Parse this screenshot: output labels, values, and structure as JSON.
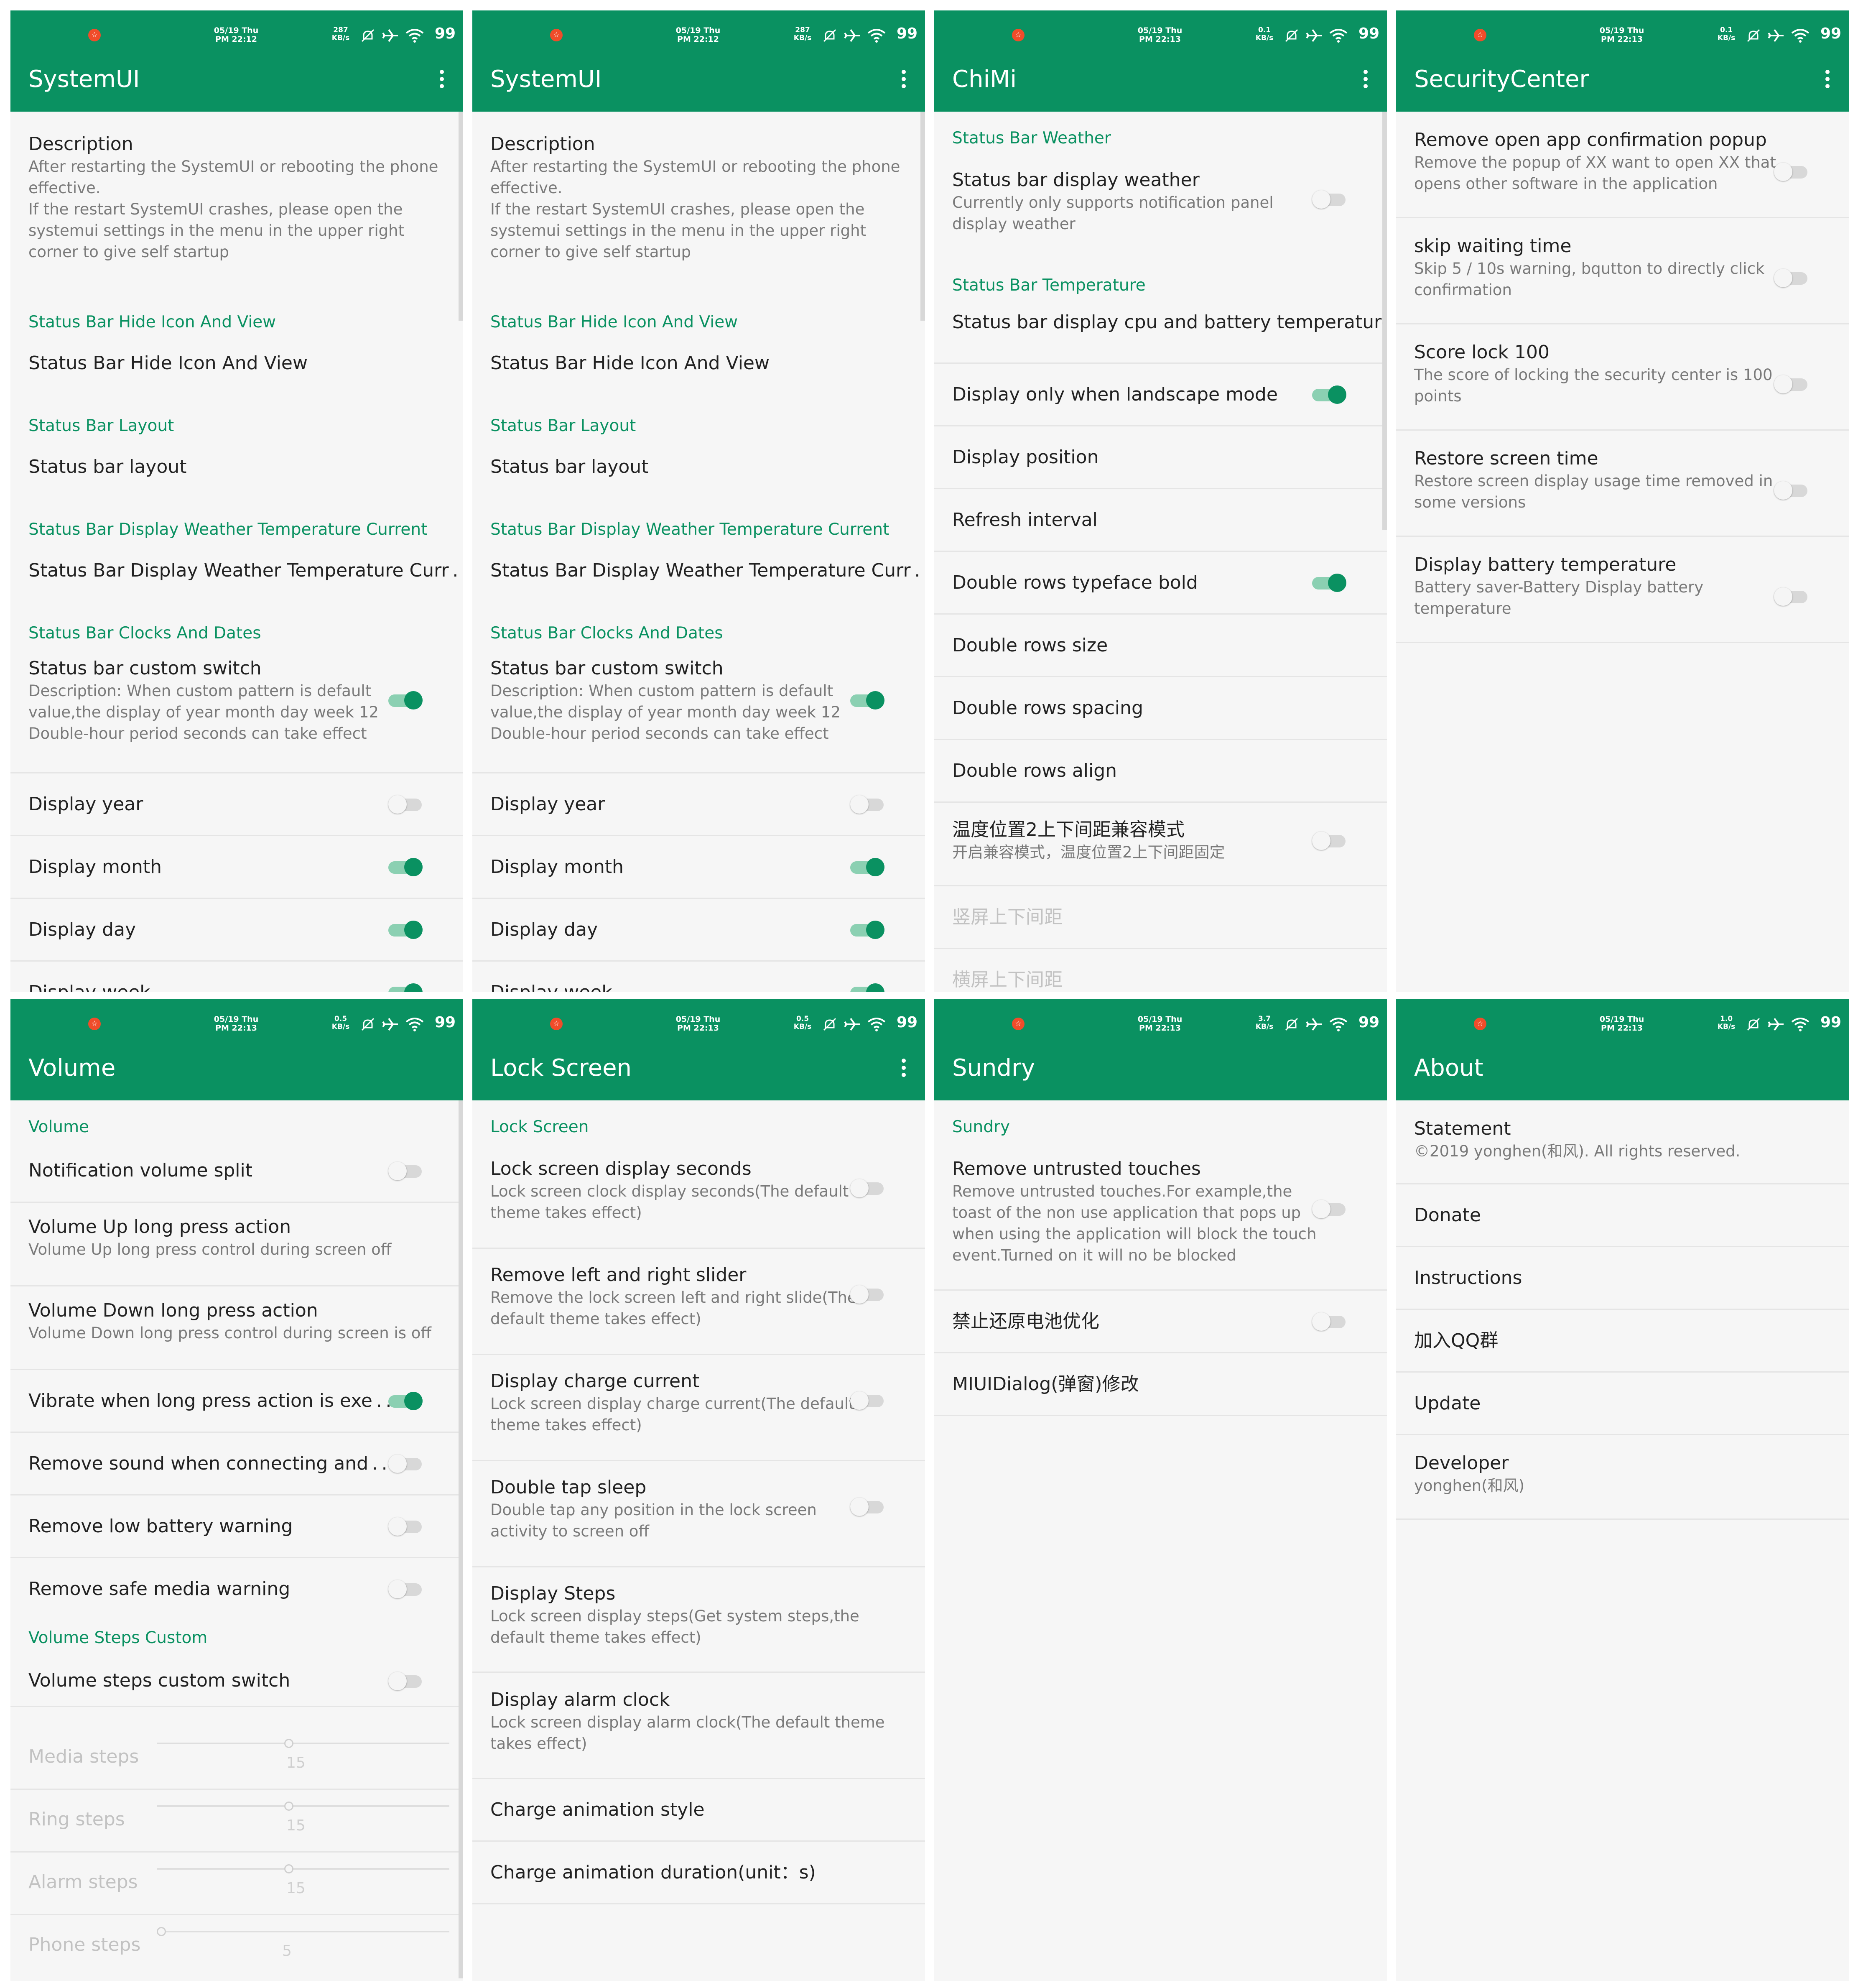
{
  "statusbar": {
    "panels": [
      {
        "date": "05/19 Thu",
        "time": "PM 22:12",
        "speed": "287",
        "speed_unit": "KB/s",
        "battery": "99"
      },
      {
        "date": "05/19 Thu",
        "time": "PM 22:12",
        "speed": "287",
        "speed_unit": "KB/s",
        "battery": "99"
      },
      {
        "date": "05/19 Thu",
        "time": "PM 22:13",
        "speed": "0.1",
        "speed_unit": "KB/s",
        "battery": "99"
      },
      {
        "date": "05/19 Thu",
        "time": "PM 22:13",
        "speed": "0.1",
        "speed_unit": "KB/s",
        "battery": "99"
      },
      {
        "date": "05/19 Thu",
        "time": "PM 22:13",
        "speed": "0.5",
        "speed_unit": "KB/s",
        "battery": "99"
      },
      {
        "date": "05/19 Thu",
        "time": "PM 22:13",
        "speed": "0.5",
        "speed_unit": "KB/s",
        "battery": "99"
      },
      {
        "date": "05/19 Thu",
        "time": "PM 22:13",
        "speed": "3.7",
        "speed_unit": "KB/s",
        "battery": "99"
      },
      {
        "date": "05/19 Thu",
        "time": "PM 22:13",
        "speed": "1.0",
        "speed_unit": "KB/s",
        "battery": "99"
      }
    ]
  },
  "colors": {
    "accent": "#0a9161",
    "toggle_on": "#0a9161",
    "toggle_off": "#d8d8d8"
  },
  "systemui": {
    "title": "SystemUI",
    "description_title": "Description",
    "description_text": "After restarting the SystemUI or rebooting the phone effective.\nIf the restart SystemUI crashes, please open the systemui settings in the menu in the upper right corner to give self startup",
    "cat_hide": "Status Bar Hide Icon And View",
    "item_hide": "Status Bar Hide Icon And View",
    "cat_layout": "Status Bar Layout",
    "item_layout": "Status bar layout",
    "cat_weather": "Status Bar Display Weather Temperature Current",
    "item_weather": "Status Bar Display Weather Temperature Curr . .",
    "cat_clocks": "Status Bar Clocks And Dates",
    "custom_switch_title": "Status bar custom switch",
    "custom_switch_desc": "Description: When custom pattern is default value,the display of year month day week 12 Double-hour period seconds can take effect",
    "custom_switch_on": true,
    "display_year": "Display year",
    "display_year_on": false,
    "display_month": "Display month",
    "display_month_on": true,
    "display_day": "Display day",
    "display_day_on": true,
    "display_week": "Display week",
    "display_week_on": true
  },
  "chimi": {
    "title": "ChiMi",
    "cat_weather": "Status Bar Weather",
    "weather_title": "Status bar display weather",
    "weather_desc": "Currently only supports notification panel display weather",
    "weather_on": false,
    "cat_temp": "Status Bar Temperature",
    "temp_item": "Status bar display cpu and battery temperature",
    "landscape": "Display only when landscape mode",
    "landscape_on": true,
    "position": "Display position",
    "refresh": "Refresh interval",
    "bold": "Double rows typeface bold",
    "bold_on": true,
    "size": "Double rows size",
    "spacing": "Double rows spacing",
    "align": "Double rows align",
    "compat_title": "温度位置2上下间距兼容模式",
    "compat_desc": "开启兼容模式，温度位置2上下间距固定",
    "compat_on": false,
    "portrait_spacing": "竖屏上下间距",
    "landscape_spacing": "横屏上下间距"
  },
  "security": {
    "title": "SecurityCenter",
    "items": [
      {
        "title": "Remove open app confirmation popup",
        "desc": "Remove the popup of XX want to open XX that opens other software in the application",
        "on": false
      },
      {
        "title": "skip waiting time",
        "desc": "Skip 5 / 10s warning, bqutton to directly click confirmation",
        "on": false
      },
      {
        "title": "Score lock 100",
        "desc": "The score of locking the security center is 100 points",
        "on": false
      },
      {
        "title": "Restore screen time",
        "desc": "Restore screen display usage time removed in some versions",
        "on": false
      },
      {
        "title": "Display battery temperature",
        "desc": "Battery saver-Battery Display battery temperature",
        "on": false
      }
    ]
  },
  "volume": {
    "title": "Volume",
    "cat_volume": "Volume",
    "split": "Notification volume split",
    "split_on": false,
    "up_title": "Volume Up long press action",
    "up_desc": "Volume Up long press control during screen off",
    "down_title": "Volume Down long press action",
    "down_desc": "Volume Down long press control during screen is off",
    "vibrate": "Vibrate when long press action is exe . .",
    "vibrate_on": true,
    "sound": "Remove sound when connecting and . .",
    "sound_on": false,
    "low_batt": "Remove low battery warning",
    "low_batt_on": false,
    "safe_media": "Remove safe media warning",
    "safe_media_on": false,
    "cat_steps": "Volume Steps Custom",
    "steps_switch": "Volume steps custom switch",
    "steps_switch_on": false,
    "media_steps": "Media steps",
    "media_value": "15",
    "ring_steps": "Ring steps",
    "ring_value": "15",
    "alarm_steps": "Alarm steps",
    "alarm_value": "15",
    "phone_steps": "Phone steps",
    "phone_value": "5"
  },
  "lockscreen": {
    "title": "Lock Screen",
    "cat": "Lock Screen",
    "items": [
      {
        "title": "Lock screen display seconds",
        "desc": "Lock screen clock display seconds(The default theme takes effect)",
        "on": false
      },
      {
        "title": "Remove left and right slider",
        "desc": "Remove the lock screen left and right slide(The default theme takes effect)",
        "on": false
      },
      {
        "title": "Display charge current",
        "desc": "Lock screen display charge current(The default theme takes effect)",
        "on": false
      },
      {
        "title": "Double tap sleep",
        "desc": "Double tap any position in the lock screen activity to screen off",
        "on": false
      }
    ],
    "steps_title": "Display Steps",
    "steps_desc": "Lock screen display steps(Get system steps,the default theme takes effect)",
    "alarm_title": "Display alarm clock",
    "alarm_desc": "Lock screen display alarm clock(The default theme takes effect)",
    "anim_style": "Charge animation style",
    "anim_duration": "Charge animation duration(unit：s)"
  },
  "sundry": {
    "title": "Sundry",
    "cat": "Sundry",
    "touch_title": "Remove untrusted touches",
    "touch_desc": "Remove untrusted touches.For example,the toast of the non use application that pops up when using the application will block the touch event.Turned on it will no be blocked",
    "touch_on": false,
    "battery_opt": "禁止还原电池优化",
    "battery_opt_on": false,
    "dialog": "MIUIDialog(弹窗)修改"
  },
  "about": {
    "title": "About",
    "statement_title": "Statement",
    "statement_desc": "©2019 yonghen(和风). All rights reserved.",
    "donate": "Donate",
    "instructions": "Instructions",
    "qq": "加入QQ群",
    "update": "Update",
    "developer_title": "Developer",
    "developer_desc": "yonghen(和风)"
  }
}
